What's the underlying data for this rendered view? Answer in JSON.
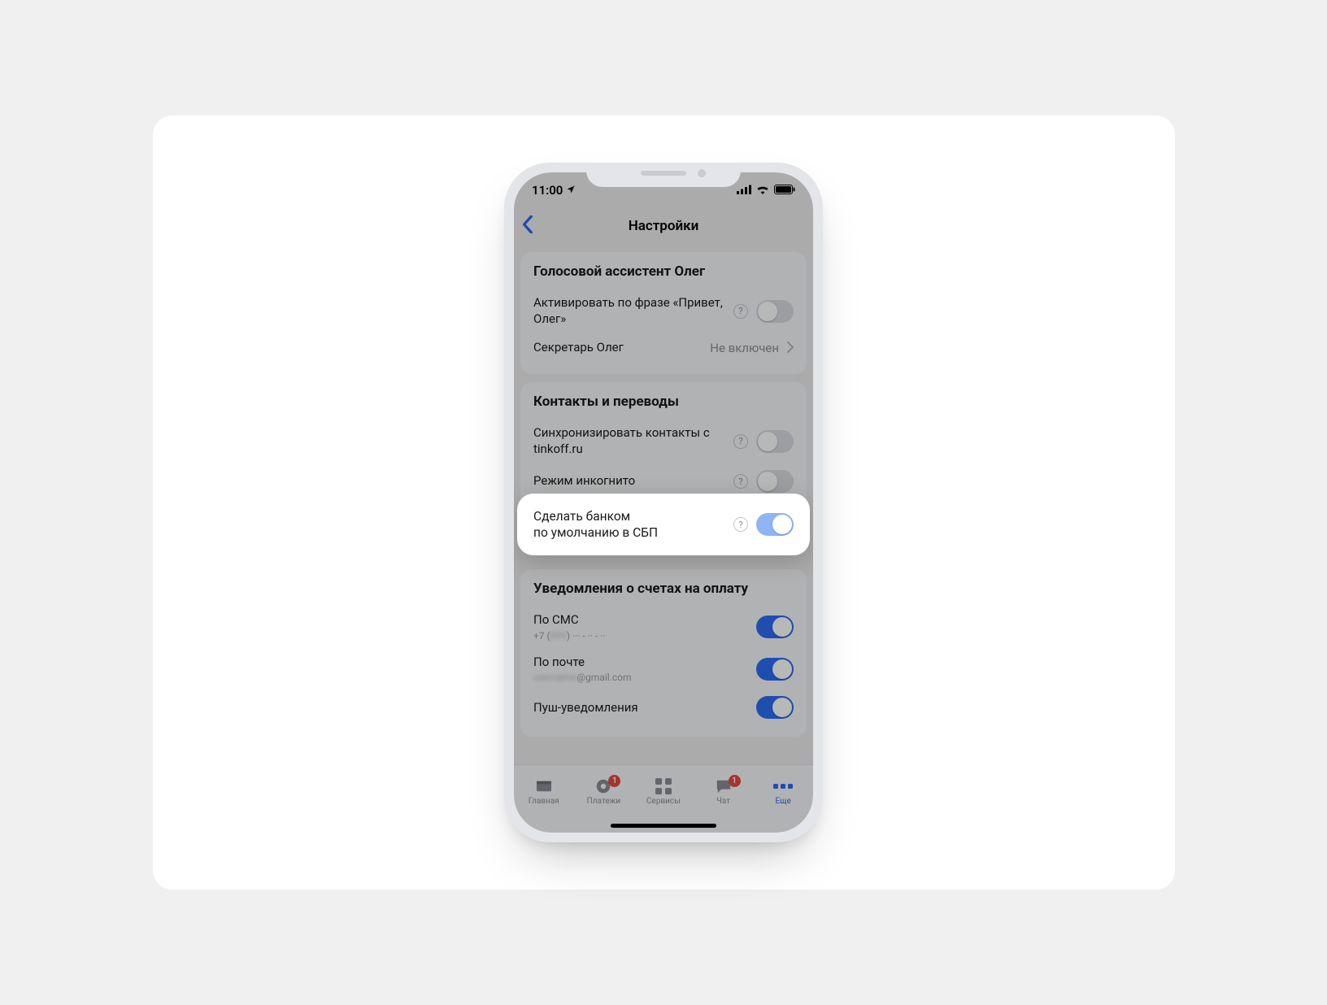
{
  "status": {
    "time": "11:00"
  },
  "nav": {
    "title": "Настройки"
  },
  "sections": {
    "assistant": {
      "title": "Голосовой ассистент Олег",
      "activate_label": "Активировать по фразе «Привет, Олег»",
      "secretary_label": "Секретарь Олег",
      "secretary_value": "Не включен"
    },
    "contacts": {
      "title": "Контакты и переводы",
      "sync_label": "Синхронизировать контакты с tinkoff.ru",
      "incognito_label": "Режим инкогнито"
    },
    "highlight": {
      "label_line1": "Сделать банком",
      "label_line2": "по умолчанию в СБП"
    },
    "notifications": {
      "title": "Уведомления о счетах на оплату",
      "sms_label": "По СМС",
      "sms_sub_prefix": "+7 (",
      "sms_sub_suffix": ")  ··· - ·· - ··",
      "email_label": "По почте",
      "email_sub_suffix": "@gmail.com",
      "push_label": "Пуш-уведомления"
    }
  },
  "tabs": {
    "home": "Главная",
    "payments": "Платежи",
    "services": "Сервисы",
    "chat": "Чат",
    "more": "Еще",
    "payments_badge": "1",
    "chat_badge": "1"
  }
}
